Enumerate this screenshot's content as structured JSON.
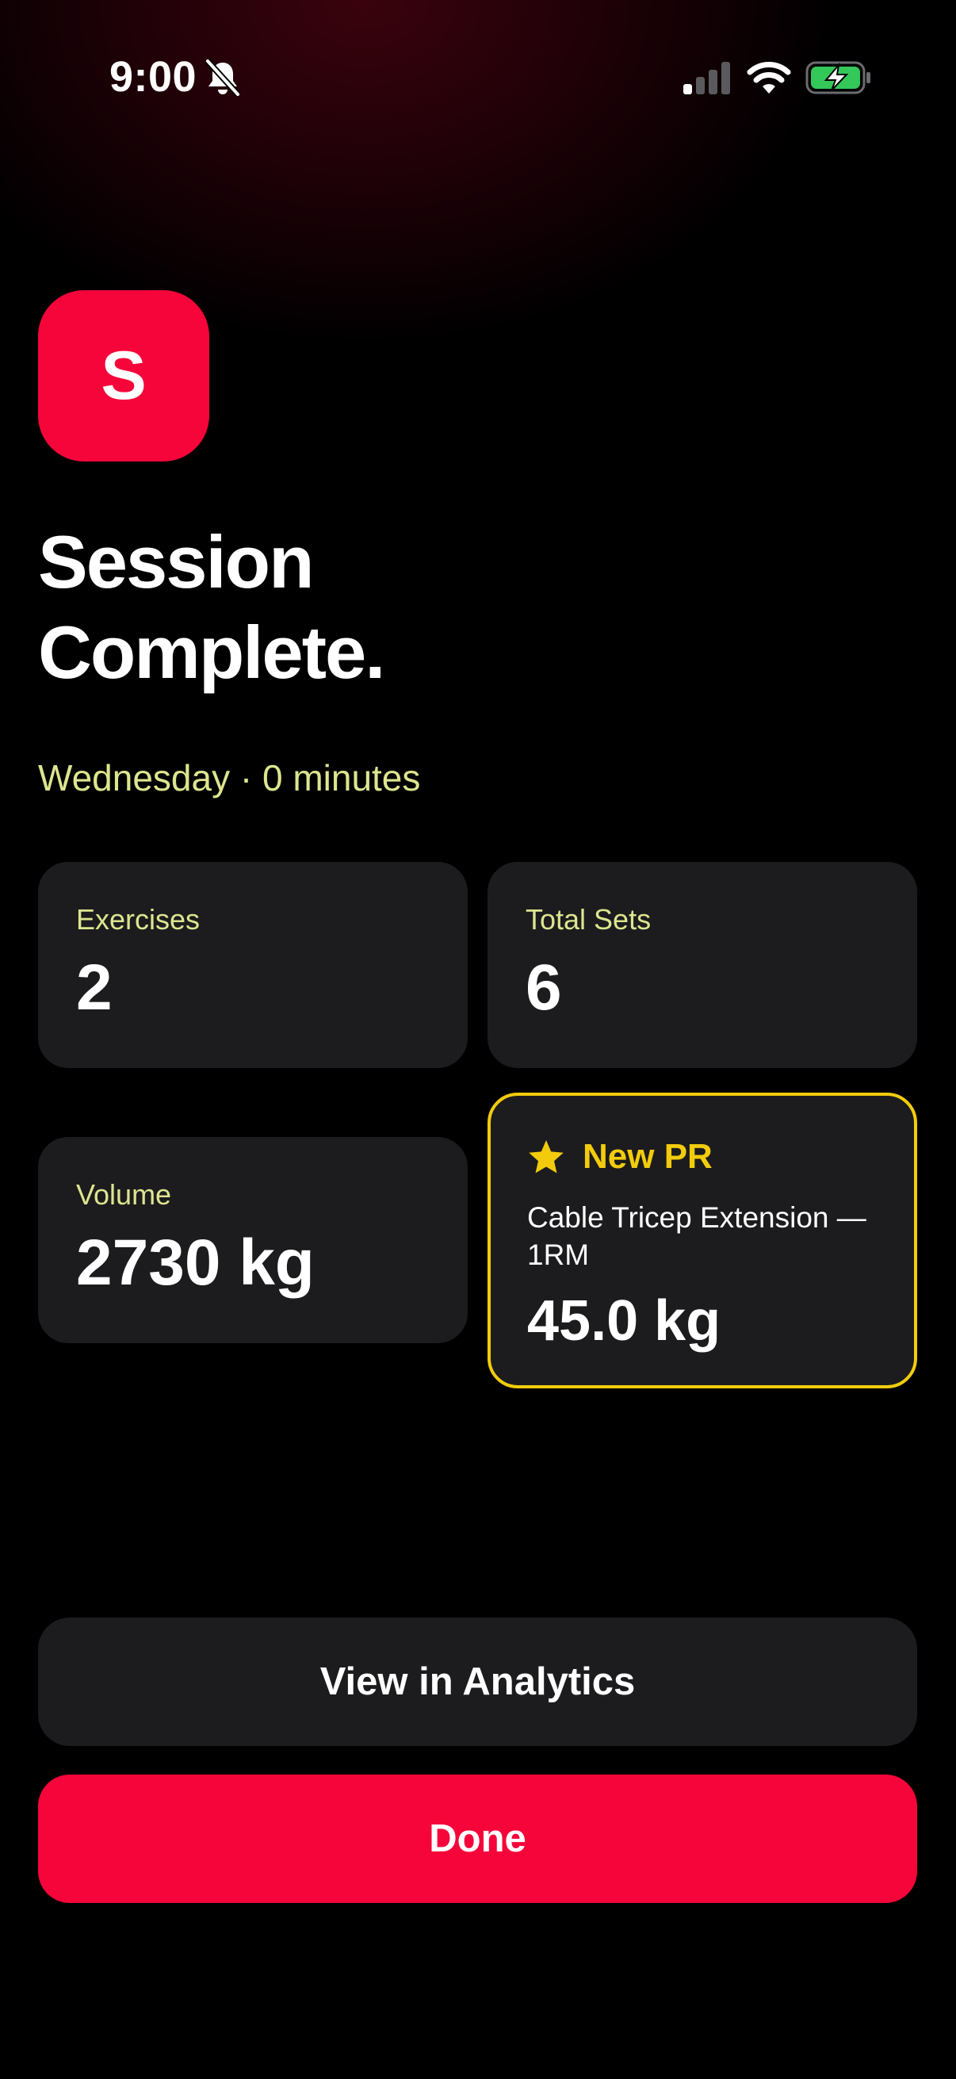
{
  "status_bar": {
    "time": "9:00",
    "icons": [
      "bell-slash-icon",
      "cellular-signal-icon",
      "wifi-icon",
      "battery-charging-icon"
    ]
  },
  "app_badge": {
    "letter": "S"
  },
  "header": {
    "title_line1": "Session",
    "title_line2": "Complete.",
    "subtitle": "Wednesday · 0 minutes"
  },
  "stats": {
    "exercises": {
      "label": "Exercises",
      "value": "2"
    },
    "total_sets": {
      "label": "Total Sets",
      "value": "6"
    },
    "volume": {
      "label": "Volume",
      "value": "2730 kg"
    }
  },
  "pr_card": {
    "icon": "star-icon",
    "title": "New PR",
    "exercise": "Cable Tricep Extension — 1RM",
    "value": "45.0 kg"
  },
  "actions": {
    "analytics_label": "View in Analytics",
    "done_label": "Done"
  },
  "colors": {
    "accent_red": "#f5053a",
    "label_yellow_green": "#dde58f",
    "pr_gold": "#f2cc0c",
    "card_bg": "#1c1c1e",
    "battery_green": "#34c759"
  }
}
